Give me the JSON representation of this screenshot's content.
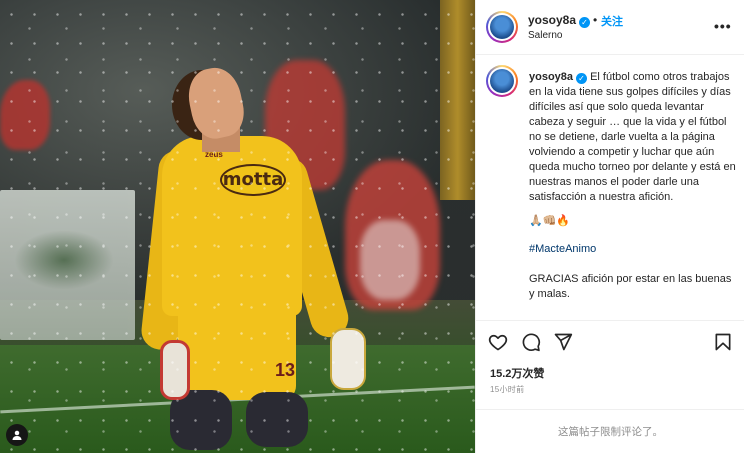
{
  "post": {
    "username": "yosoy8a",
    "verified_mark": "✓",
    "dot": "•",
    "follow_label": "关注",
    "location": "Salerno",
    "more_icon": "more-options-icon"
  },
  "caption": {
    "text": "El fútbol como otros trabajos en la vida tiene sus golpes difíciles y días difíciles así que solo queda levantar cabeza y seguir … que la vida y el fútbol no se detiene, darle vuelta a la página volviendo a competir y luchar que aún queda mucho torneo por delante y está en nuestras manos el poder darle una satisfacción a nuestra afición.",
    "emojis": "🙏🏼👊🏼🔥",
    "hashtag": "#MacteAnimo",
    "gracias": "GRACIAS afición por estar en las buenas y malas."
  },
  "actions": {
    "icons": [
      "heart-icon",
      "comment-icon",
      "share-icon",
      "bookmark-icon"
    ],
    "likes": "15.2万次赞",
    "time": "15小时前",
    "comments_disabled": "这篇帖子限制评论了。"
  },
  "photo": {
    "sponsor": "motta",
    "kit_brand": "zeus",
    "shirt_number": "13",
    "tag_icon": "user-tag-icon"
  },
  "colors": {
    "accent": "#0095f6",
    "text": "#262626",
    "muted": "#8e8e8e",
    "hashtag": "#00376b",
    "kit_yellow": "#f2c21c"
  }
}
